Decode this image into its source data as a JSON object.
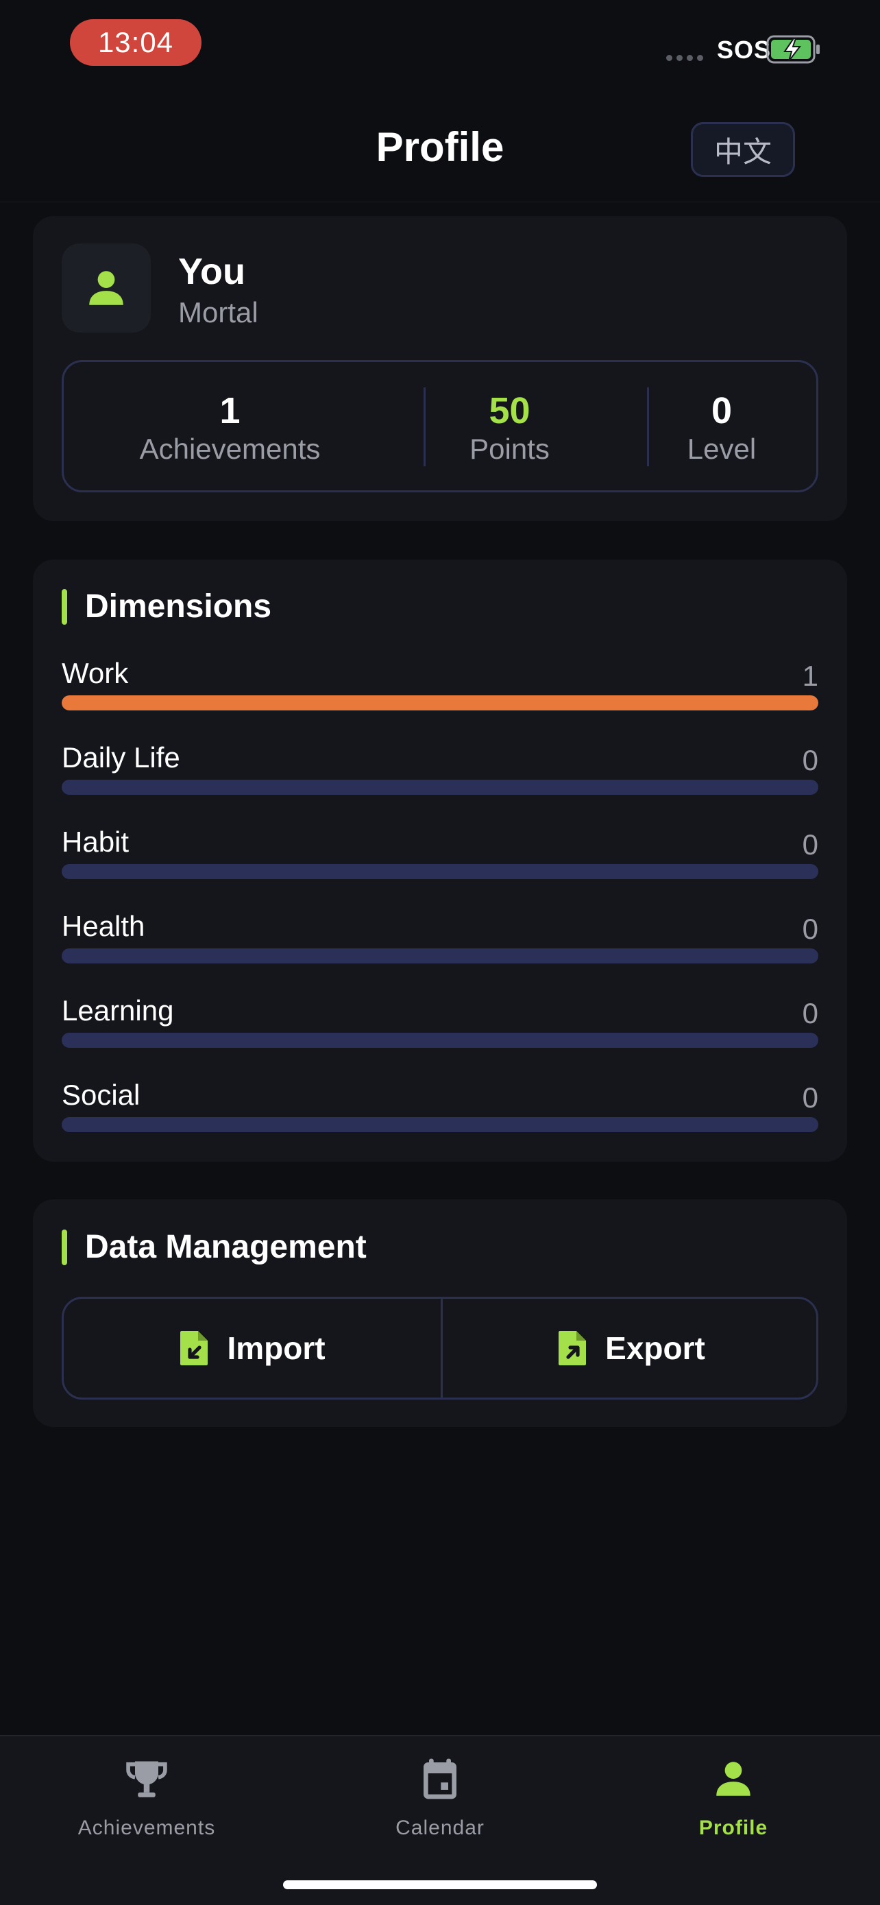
{
  "status_bar": {
    "time": "13:04",
    "carrier": "SOS",
    "battery_charging": true,
    "time_pill_color": "#d0463d"
  },
  "header": {
    "title": "Profile",
    "language_button": "中文"
  },
  "profile": {
    "name": "You",
    "rank": "Mortal",
    "avatar_icon": "person-icon",
    "stats": [
      {
        "value": "1",
        "label": "Achievements"
      },
      {
        "value": "50",
        "label": "Points"
      },
      {
        "value": "0",
        "label": "Level"
      }
    ]
  },
  "dimensions": {
    "title": "Dimensions",
    "items": [
      {
        "label": "Work",
        "value": "1",
        "fill_fraction": 1.0
      },
      {
        "label": "Daily Life",
        "value": "0",
        "fill_fraction": 0
      },
      {
        "label": "Habit",
        "value": "0",
        "fill_fraction": 0
      },
      {
        "label": "Health",
        "value": "0",
        "fill_fraction": 0
      },
      {
        "label": "Learning",
        "value": "0",
        "fill_fraction": 0
      },
      {
        "label": "Social",
        "value": "0",
        "fill_fraction": 0
      }
    ]
  },
  "data_management": {
    "title": "Data Management",
    "import_label": "Import",
    "export_label": "Export",
    "import_icon": "file-import-icon",
    "export_icon": "file-export-icon"
  },
  "tab_bar": {
    "tabs": [
      {
        "label": "Achievements",
        "icon": "trophy-icon",
        "active": false
      },
      {
        "label": "Calendar",
        "icon": "calendar-icon",
        "active": false
      },
      {
        "label": "Profile",
        "icon": "person-icon",
        "active": true
      }
    ]
  },
  "colors": {
    "accent": "#a3e04a",
    "background": "#0d0e12",
    "card": "#15161b",
    "border": "#2b3050",
    "work_bar": "#e8793a",
    "empty_bar": "#2b3058"
  }
}
